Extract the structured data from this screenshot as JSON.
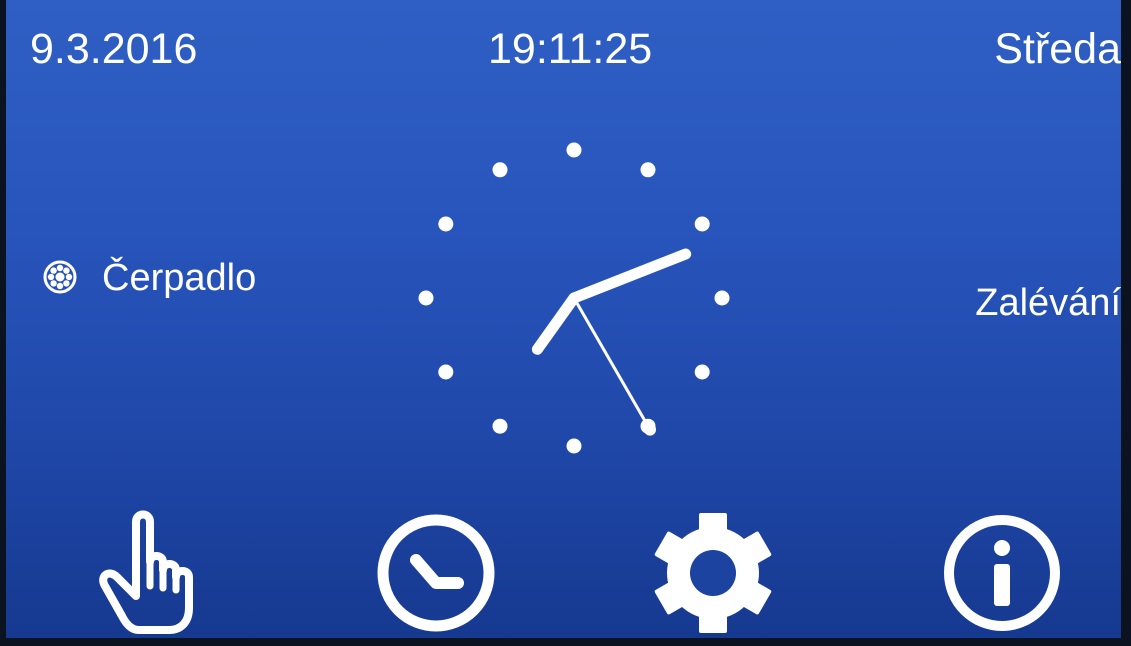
{
  "header": {
    "date": "9.3.2016",
    "time": "19:11:25",
    "day": "Středa"
  },
  "status": {
    "pump_label": "Čerpadlo",
    "watering_label": "Zalévání"
  },
  "clock": {
    "hours": 19,
    "minutes": 11,
    "seconds": 25
  },
  "nav": {
    "icons": [
      "hand-pointer-icon",
      "clock-icon",
      "gear-icon",
      "info-icon"
    ]
  },
  "colors": {
    "foreground": "#ffffff",
    "background_top": "#2f5fc4",
    "background_bottom": "#163990"
  }
}
